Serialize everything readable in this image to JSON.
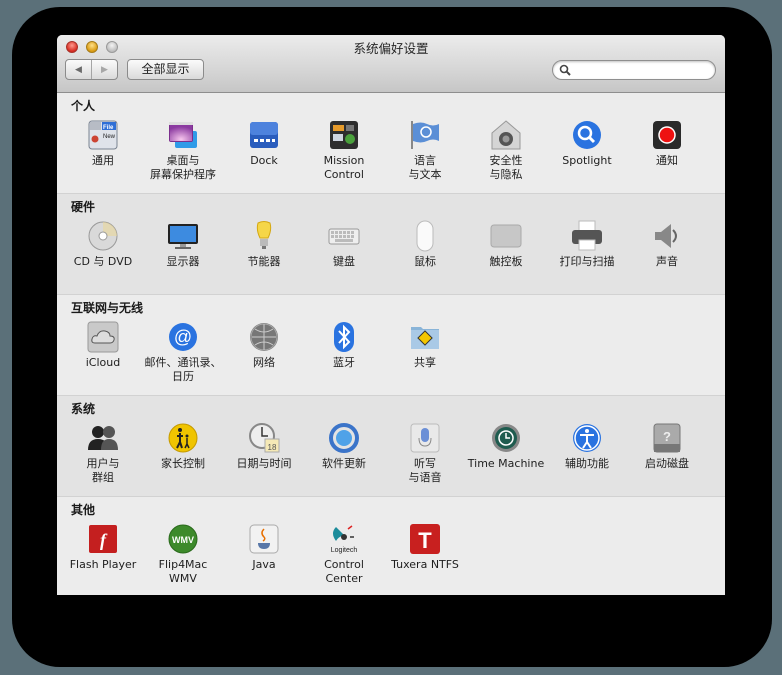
{
  "window": {
    "title": "系统偏好设置",
    "nav_back_glyph": "◀",
    "nav_forward_glyph": "▶",
    "show_all_label": "全部显示",
    "search_placeholder": "",
    "search_value": ""
  },
  "sections": [
    {
      "title": "个人",
      "items": [
        {
          "label": "通用",
          "icon": "general-icon"
        },
        {
          "label": "桌面与\n屏幕保护程序",
          "icon": "desktop-screensaver-icon"
        },
        {
          "label": "Dock",
          "icon": "dock-icon"
        },
        {
          "label": "Mission\nControl",
          "icon": "mission-control-icon"
        },
        {
          "label": "语言\n与文本",
          "icon": "language-text-icon"
        },
        {
          "label": "安全性\n与隐私",
          "icon": "security-privacy-icon"
        },
        {
          "label": "Spotlight",
          "icon": "spotlight-icon"
        },
        {
          "label": "通知",
          "icon": "notifications-icon"
        }
      ]
    },
    {
      "title": "硬件",
      "items": [
        {
          "label": "CD 与 DVD",
          "icon": "cd-dvd-icon"
        },
        {
          "label": "显示器",
          "icon": "displays-icon"
        },
        {
          "label": "节能器",
          "icon": "energy-saver-icon"
        },
        {
          "label": "键盘",
          "icon": "keyboard-icon"
        },
        {
          "label": "鼠标",
          "icon": "mouse-icon"
        },
        {
          "label": "触控板",
          "icon": "trackpad-icon"
        },
        {
          "label": "打印与扫描",
          "icon": "print-scan-icon"
        },
        {
          "label": "声音",
          "icon": "sound-icon"
        }
      ]
    },
    {
      "title": "互联网与无线",
      "items": [
        {
          "label": "iCloud",
          "icon": "icloud-icon"
        },
        {
          "label": "邮件、通讯录、\n日历",
          "icon": "mail-contacts-calendars-icon"
        },
        {
          "label": "网络",
          "icon": "network-icon"
        },
        {
          "label": "蓝牙",
          "icon": "bluetooth-icon"
        },
        {
          "label": "共享",
          "icon": "sharing-icon"
        }
      ]
    },
    {
      "title": "系统",
      "items": [
        {
          "label": "用户与\n群组",
          "icon": "users-groups-icon"
        },
        {
          "label": "家长控制",
          "icon": "parental-controls-icon"
        },
        {
          "label": "日期与时间",
          "icon": "date-time-icon"
        },
        {
          "label": "软件更新",
          "icon": "software-update-icon"
        },
        {
          "label": "听写\n与语音",
          "icon": "dictation-speech-icon"
        },
        {
          "label": "Time Machine",
          "icon": "time-machine-icon"
        },
        {
          "label": "辅助功能",
          "icon": "accessibility-icon"
        },
        {
          "label": "启动磁盘",
          "icon": "startup-disk-icon"
        }
      ]
    },
    {
      "title": "其他",
      "items": [
        {
          "label": "Flash Player",
          "icon": "flash-player-icon"
        },
        {
          "label": "Flip4Mac\nWMV",
          "icon": "flip4mac-icon"
        },
        {
          "label": "Java",
          "icon": "java-icon"
        },
        {
          "label": "Control Center",
          "icon": "logitech-control-center-icon",
          "icon_text": "Logitech"
        },
        {
          "label": "Tuxera NTFS",
          "icon": "tuxera-ntfs-icon",
          "icon_text": "T"
        }
      ]
    }
  ],
  "colors": {
    "desktop": "#5b7079",
    "section_light": "#ececec",
    "section_dark": "#e3e3e3",
    "accent_blue": "#2a73e0"
  }
}
